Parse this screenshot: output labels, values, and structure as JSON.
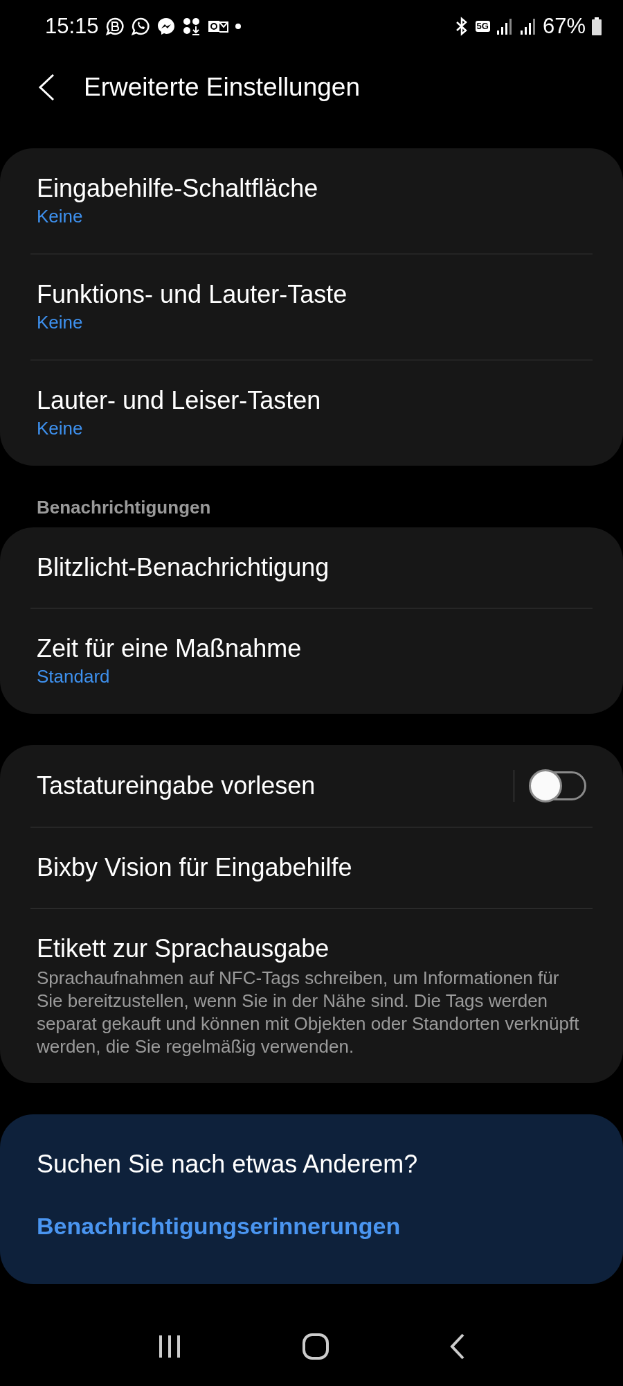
{
  "status_bar": {
    "time": "15:15",
    "network": "5G",
    "battery": "67%"
  },
  "header": {
    "title": "Erweiterte Einstellungen"
  },
  "groups": [
    {
      "items": [
        {
          "kind": "plain",
          "title": "Eingabehilfe-Schaltfläche",
          "value": "Keine"
        },
        {
          "kind": "plain",
          "title": "Funktions- und Lauter-Taste",
          "value": "Keine"
        },
        {
          "kind": "plain",
          "title": "Lauter- und Leiser-Tasten",
          "value": "Keine"
        }
      ]
    },
    {
      "heading": "Benachrichtigungen",
      "items": [
        {
          "kind": "plain",
          "title": "Blitzlicht-Benachrichtigung"
        },
        {
          "kind": "plain",
          "title": "Zeit für eine Maßnahme",
          "value": "Standard"
        }
      ]
    },
    {
      "items": [
        {
          "kind": "toggle",
          "title": "Tastatureingabe vorlesen",
          "on": false
        },
        {
          "kind": "plain",
          "title": "Bixby Vision für Eingabehilfe"
        },
        {
          "kind": "plain",
          "title": "Etikett zur Sprachausgabe",
          "description": "Sprachaufnahmen auf NFC-Tags schreiben, um Informationen für Sie bereitzustellen, wenn Sie in der Nähe sind. Die Tags werden separat gekauft und können mit Objekten oder Standorten verknüpft werden, die Sie regelmäßig verwenden."
        }
      ]
    }
  ],
  "suggestion": {
    "title": "Suchen Sie nach etwas Anderem?",
    "link": "Benachrichtigungserinnerungen"
  }
}
